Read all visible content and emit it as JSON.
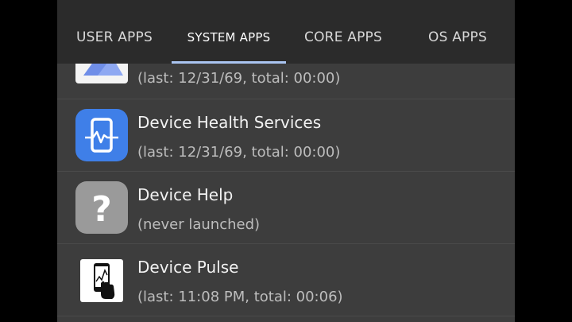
{
  "tabs": [
    {
      "label": "USER APPS"
    },
    {
      "label": "SYSTEM APPS"
    },
    {
      "label": "CORE APPS"
    },
    {
      "label": "OS APPS"
    }
  ],
  "active_tab": "SYSTEM APPS",
  "apps": [
    {
      "name": "",
      "detail": "(last: 12/31/69, total: 00:00)",
      "icon": "image-placeholder-icon"
    },
    {
      "name": "Device Health Services",
      "detail": "(last: 12/31/69, total: 00:00)",
      "icon": "device-health-icon"
    },
    {
      "name": "Device Help",
      "detail": "(never launched)",
      "icon": "question-mark-icon"
    },
    {
      "name": "Device Pulse",
      "detail": "(last: 11:08 PM, total: 00:06)",
      "icon": "device-pulse-icon"
    }
  ],
  "colors": {
    "tab_underline": "#a9c4f0",
    "device_health_blue": "#3f7fe8",
    "help_grey": "#9a9a9a"
  }
}
